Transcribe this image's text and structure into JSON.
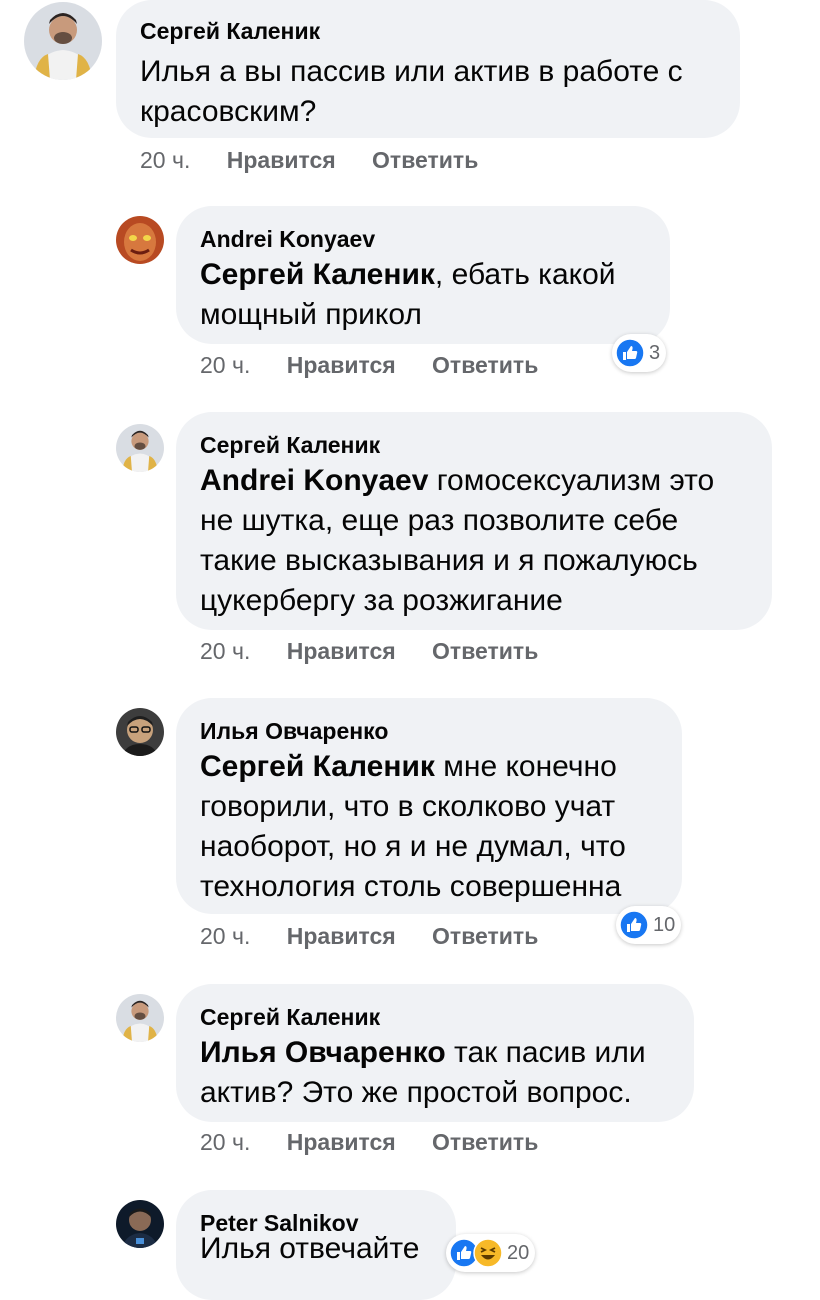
{
  "comments": [
    {
      "author": "Сергей Каленик",
      "mention": "",
      "lines": [
        "Илья а вы пассив или актив в работе с",
        "красовским?"
      ],
      "time": "20 ч.",
      "like_label": "Нравится",
      "reply_label": "Ответить",
      "reaction_count": ""
    },
    {
      "author": "Andrei Konyaev",
      "mention": "Сергей Каленик",
      "lines": [
        ", ебать какой",
        "мощный прикол"
      ],
      "time": "20 ч.",
      "like_label": "Нравится",
      "reply_label": "Ответить",
      "reaction_count": "3"
    },
    {
      "author": "Сергей Каленик",
      "mention": "Andrei Konyaev",
      "lines": [
        " гомосексуализм это",
        "не шутка, еще раз позволите себе",
        "такие высказывания и я пожалуюсь",
        "цукербергу за розжигание"
      ],
      "time": "20 ч.",
      "like_label": "Нравится",
      "reply_label": "Ответить",
      "reaction_count": ""
    },
    {
      "author": "Илья Овчаренко",
      "mention": "Сергей Каленик",
      "lines": [
        " мне конечно",
        "говорили, что в сколково учат",
        "наоборот, но я и не думал, что",
        "технология столь совершенна"
      ],
      "time": "20 ч.",
      "like_label": "Нравится",
      "reply_label": "Ответить",
      "reaction_count": "10"
    },
    {
      "author": "Сергей Каленик",
      "mention": "Илья Овчаренко",
      "lines": [
        " так пасив или",
        "актив? Это же простой вопрос."
      ],
      "time": "20 ч.",
      "like_label": "Нравится",
      "reply_label": "Ответить",
      "reaction_count": ""
    },
    {
      "author": "Peter Salnikov",
      "mention": "",
      "lines": [
        "Илья отвечайте"
      ],
      "time": "",
      "like_label": "",
      "reply_label": "",
      "reaction_count": "20"
    }
  ],
  "colors": {
    "bubble": "#f0f2f5",
    "meta_text": "#65676b",
    "like_blue": "#1877f2",
    "haha_yellow": "#f7b928"
  },
  "icons": [
    "avatar-sergey",
    "avatar-andrei",
    "avatar-ilya",
    "avatar-peter",
    "like-icon",
    "haha-icon"
  ]
}
